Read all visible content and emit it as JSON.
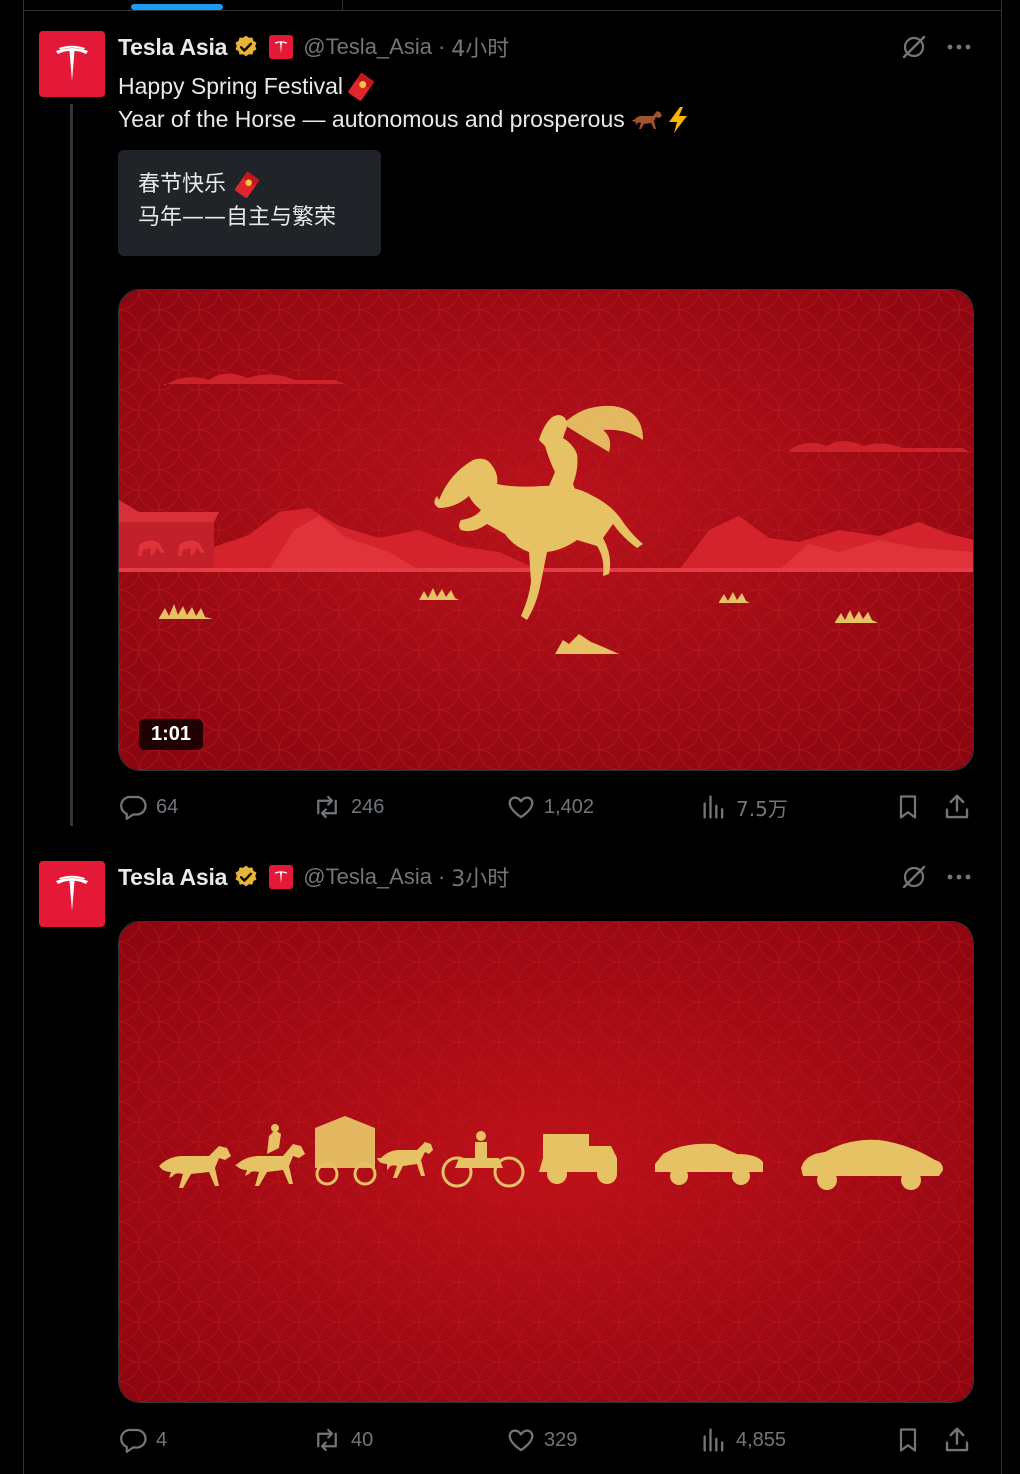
{
  "colors": {
    "brand_red": "#e31937",
    "accent_blue": "#1d9bf0",
    "muted": "#71767b",
    "text": "#e7e9ea",
    "gold": "#e6c265",
    "media_red": "#b00812"
  },
  "tweets": [
    {
      "author": {
        "name": "Tesla Asia",
        "handle": "@Tesla_Asia",
        "avatar_icon": "tesla-logo-icon",
        "verified_icon": "gold-verified-badge-icon",
        "affiliate_icon": "tesla-affiliate-badge-icon"
      },
      "separator": "·",
      "time": "4小时",
      "text_lines": [
        "Happy Spring Festival",
        "Year of the Horse — autonomous and prosperous"
      ],
      "text_emoji": [
        "red-envelope-icon",
        "horse-icon",
        "lightning-icon"
      ],
      "translation_lines": [
        "春节快乐",
        "马年——自主与繁荣"
      ],
      "media": {
        "type": "video",
        "duration": "1:01",
        "description_icon": "horse-rider-illustration"
      },
      "stats": {
        "replies": "64",
        "reposts": "246",
        "likes": "1,402",
        "views": "7.5万"
      }
    },
    {
      "author": {
        "name": "Tesla Asia",
        "handle": "@Tesla_Asia",
        "avatar_icon": "tesla-logo-icon",
        "verified_icon": "gold-verified-badge-icon",
        "affiliate_icon": "tesla-affiliate-badge-icon"
      },
      "separator": "·",
      "time": "3小时",
      "media": {
        "type": "image",
        "description_icon": "horse-to-car-evolution-illustration"
      },
      "stats": {
        "replies": "4",
        "reposts": "40",
        "likes": "329",
        "views": "4,855"
      }
    }
  ]
}
